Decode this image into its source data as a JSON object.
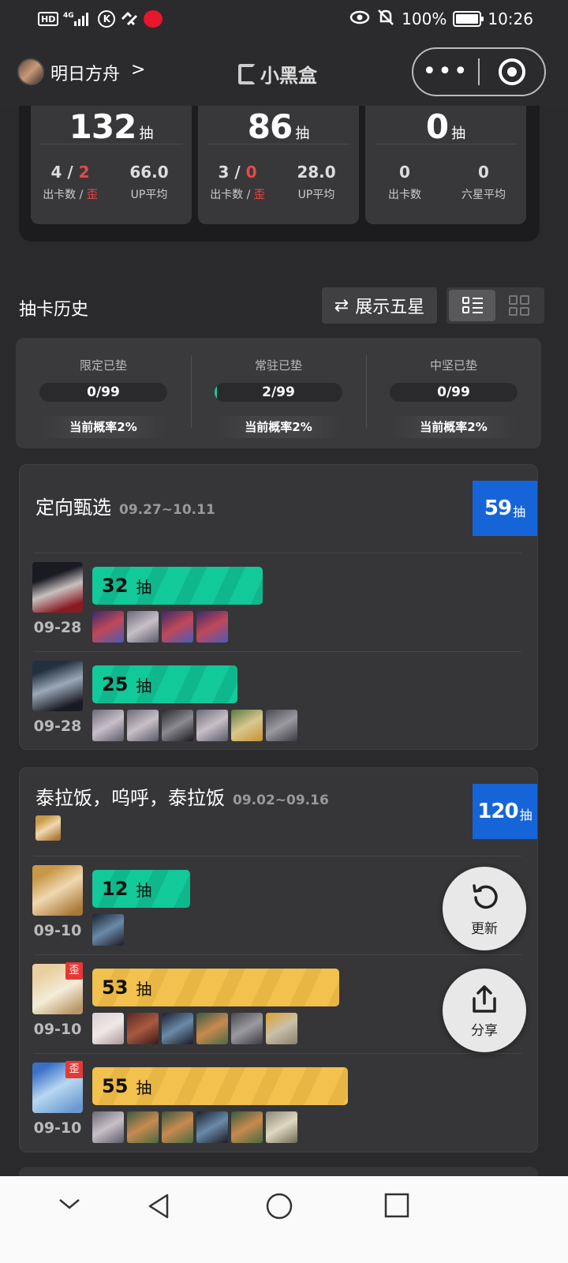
{
  "status_bar": {
    "hd": "HD",
    "network": "4G",
    "battery": "100%",
    "time": "10:26"
  },
  "nav": {
    "game_title": "明日方舟",
    "chevron": ">",
    "app_name": "小黑盒"
  },
  "summary": [
    {
      "total": "132",
      "unit": "抽",
      "count": "4",
      "off": "2",
      "count_label": "出卡数",
      "off_label": "歪",
      "avg": "66.0",
      "avg_label": "UP平均"
    },
    {
      "total": "86",
      "unit": "抽",
      "count": "3",
      "off": "0",
      "count_label": "出卡数",
      "off_label": "歪",
      "avg": "28.0",
      "avg_label": "UP平均"
    },
    {
      "total": "0",
      "unit": "抽",
      "count": "0",
      "count_label": "出卡数",
      "avg": "0",
      "avg_label": "六星平均"
    }
  ],
  "history": {
    "title": "抽卡历史",
    "show_five_star": "展示五星",
    "view_mode": "list"
  },
  "pity": [
    {
      "label": "限定已垫",
      "value": "0/99",
      "progress": 0.0,
      "rate": "当前概率2%"
    },
    {
      "label": "常驻已垫",
      "value": "2/99",
      "progress": 0.02,
      "rate": "当前概率2%"
    },
    {
      "label": "中坚已垫",
      "value": "0/99",
      "progress": 0.0,
      "rate": "当前概率2%"
    }
  ],
  "banners": [
    {
      "name": "定向甄选",
      "dates": "09.27~10.11",
      "total": "59",
      "unit": "抽",
      "pulls": [
        {
          "date": "09-28",
          "count": "32",
          "unit": "抽",
          "color": "#12c99a",
          "off_banner": false,
          "fill": 0.4
        },
        {
          "date": "09-28",
          "count": "25",
          "unit": "抽",
          "color": "#12c99a",
          "off_banner": false,
          "fill": 0.34
        }
      ]
    },
    {
      "name": "泰拉饭，呜呼，泰拉饭",
      "dates": "09.02~09.16",
      "total": "120",
      "unit": "抽",
      "pulls": [
        {
          "date": "09-10",
          "count": "12",
          "unit": "抽",
          "color": "#12c99a",
          "off_banner": false,
          "fill": 0.23
        },
        {
          "date": "09-10",
          "count": "53",
          "unit": "抽",
          "color": "#f2c14e",
          "off_banner": true,
          "off_label": "歪",
          "fill": 0.58
        },
        {
          "date": "09-10",
          "count": "55",
          "unit": "抽",
          "color": "#f2c14e",
          "off_banner": true,
          "off_label": "歪",
          "fill": 0.6
        }
      ]
    }
  ],
  "fabs": {
    "refresh": "更新",
    "share": "分享"
  }
}
